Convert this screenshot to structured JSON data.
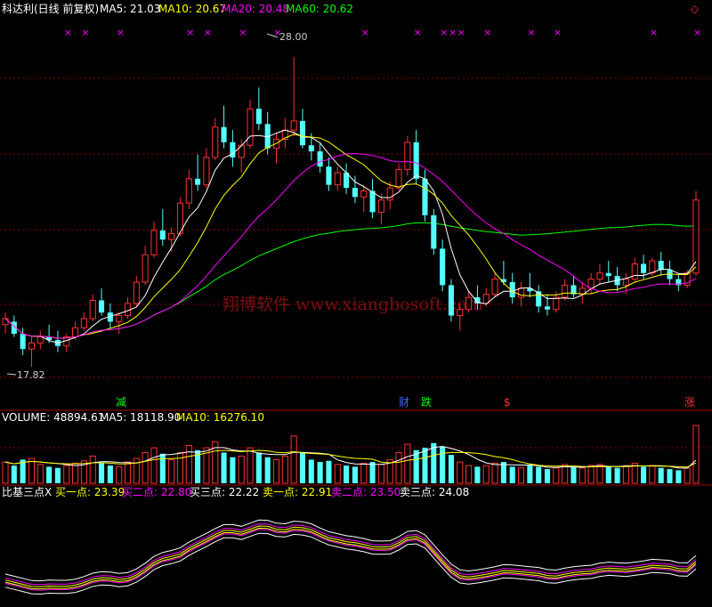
{
  "main_panel": {
    "title": "科达利(日线 前复权)",
    "ma_labels": [
      {
        "text": "MA5: 21.03",
        "color": "#ffffff"
      },
      {
        "text": "MA10: 20.67",
        "color": "#ffff00"
      },
      {
        "text": "MA20: 20.48",
        "color": "#ff00ff"
      },
      {
        "text": "MA60: 20.62",
        "color": "#00ff00"
      }
    ],
    "high_label": "28.00",
    "low_label": "17.82",
    "watermark": "翔博软件 www.xiangbosoft.com",
    "corner_symbol": "◇",
    "signal_marks": [
      "×",
      "×",
      "×",
      "×",
      "×",
      "×",
      "×",
      "×",
      "×",
      "×",
      "×",
      "×",
      "×",
      "×",
      "×",
      "×",
      "×"
    ],
    "bottom_marks": [
      {
        "text": "减",
        "color": "#00ff00"
      },
      {
        "text": "财",
        "color": "#3b6bff"
      },
      {
        "text": "跌",
        "color": "#00ff00"
      },
      {
        "text": "$",
        "color": "#ff3030"
      },
      {
        "text": "涨",
        "color": "#ff3030"
      }
    ]
  },
  "volume_panel": {
    "labels": [
      {
        "text": "VOLUME: 48894.61",
        "color": "#ffffff"
      },
      {
        "text": "MA5: 18118.90",
        "color": "#ffffff"
      },
      {
        "text": "MA10: 16276.10",
        "color": "#ffff00"
      }
    ]
  },
  "indicator_panel": {
    "labels": [
      {
        "text": "比基三点X",
        "color": "#ffffff"
      },
      {
        "text": "买一点: 23.39",
        "color": "#ffff00"
      },
      {
        "text": "买二点: 22.80",
        "color": "#ff00ff"
      },
      {
        "text": "买三点: 22.22",
        "color": "#ffffff"
      },
      {
        "text": "卖一点: 22.91",
        "color": "#ffff00"
      },
      {
        "text": "卖二点: 23.50",
        "color": "#ff00ff"
      },
      {
        "text": "卖三点: 24.08",
        "color": "#ffffff"
      }
    ]
  },
  "chart_data": {
    "type": "candlestick",
    "title": "科达利(日线 前复权)",
    "ylim": [
      17.0,
      29.0
    ],
    "y_markers": {
      "high": 28.0,
      "low": 17.82
    },
    "colors": {
      "up": "#ff3030",
      "down": "#54ffff",
      "ma5": "#ffffff",
      "ma10": "#ffff00",
      "ma20": "#ff00ff",
      "ma60": "#00ff00"
    },
    "candles": [
      [
        19.2,
        19.6,
        18.9,
        19.4
      ],
      [
        19.3,
        19.5,
        18.8,
        18.9
      ],
      [
        18.9,
        19.1,
        18.2,
        18.4
      ],
      [
        18.4,
        18.8,
        17.82,
        18.6
      ],
      [
        18.6,
        19.0,
        18.4,
        18.8
      ],
      [
        18.8,
        19.2,
        18.6,
        18.7
      ],
      [
        18.7,
        19.0,
        18.3,
        18.5
      ],
      [
        18.5,
        18.9,
        18.3,
        18.8
      ],
      [
        18.8,
        19.3,
        18.7,
        19.1
      ],
      [
        19.1,
        19.6,
        19.0,
        19.4
      ],
      [
        19.4,
        20.2,
        19.3,
        20.0
      ],
      [
        20.0,
        20.4,
        19.5,
        19.6
      ],
      [
        19.6,
        19.9,
        19.1,
        19.3
      ],
      [
        19.3,
        19.6,
        18.9,
        19.5
      ],
      [
        19.5,
        20.1,
        19.4,
        19.9
      ],
      [
        19.9,
        20.8,
        19.8,
        20.6
      ],
      [
        20.6,
        21.8,
        20.5,
        21.5
      ],
      [
        21.5,
        22.6,
        21.4,
        22.3
      ],
      [
        22.3,
        23.0,
        21.8,
        22.0
      ],
      [
        22.0,
        22.4,
        21.6,
        22.2
      ],
      [
        22.2,
        23.4,
        22.1,
        23.2
      ],
      [
        23.2,
        24.3,
        23.0,
        24.0
      ],
      [
        24.0,
        24.8,
        23.6,
        23.8
      ],
      [
        23.8,
        25.0,
        23.7,
        24.7
      ],
      [
        24.7,
        26.0,
        24.6,
        25.7
      ],
      [
        25.7,
        26.4,
        25.0,
        25.2
      ],
      [
        25.2,
        25.6,
        24.4,
        24.7
      ],
      [
        24.7,
        25.3,
        24.2,
        25.1
      ],
      [
        25.1,
        26.6,
        25.0,
        26.3
      ],
      [
        26.3,
        27.0,
        25.6,
        25.8
      ],
      [
        25.8,
        26.2,
        24.8,
        25.0
      ],
      [
        25.0,
        25.5,
        24.5,
        25.3
      ],
      [
        25.3,
        26.0,
        25.0,
        25.6
      ],
      [
        25.6,
        28.0,
        25.4,
        25.9
      ],
      [
        25.9,
        26.3,
        25.0,
        25.1
      ],
      [
        25.1,
        25.5,
        24.6,
        24.9
      ],
      [
        24.9,
        25.2,
        24.2,
        24.4
      ],
      [
        24.4,
        24.7,
        23.6,
        23.8
      ],
      [
        23.8,
        24.4,
        23.6,
        24.2
      ],
      [
        24.2,
        24.5,
        23.5,
        23.7
      ],
      [
        23.7,
        24.1,
        23.2,
        23.4
      ],
      [
        23.4,
        23.8,
        22.9,
        23.6
      ],
      [
        23.6,
        24.0,
        22.7,
        22.9
      ],
      [
        22.9,
        23.5,
        22.5,
        23.3
      ],
      [
        23.3,
        23.9,
        23.0,
        23.7
      ],
      [
        23.7,
        24.5,
        23.6,
        24.3
      ],
      [
        24.3,
        25.4,
        24.1,
        25.2
      ],
      [
        25.2,
        25.6,
        23.8,
        24.0
      ],
      [
        24.0,
        24.3,
        22.6,
        22.8
      ],
      [
        22.8,
        23.0,
        21.5,
        21.7
      ],
      [
        21.7,
        22.0,
        20.3,
        20.5
      ],
      [
        20.5,
        20.7,
        19.3,
        19.5
      ],
      [
        19.5,
        19.9,
        19.0,
        19.7
      ],
      [
        19.7,
        20.3,
        19.6,
        20.1
      ],
      [
        20.1,
        20.5,
        19.7,
        19.9
      ],
      [
        19.9,
        20.4,
        19.8,
        20.2
      ],
      [
        20.2,
        20.9,
        20.1,
        20.7
      ],
      [
        20.7,
        21.3,
        20.5,
        20.6
      ],
      [
        20.6,
        20.9,
        19.9,
        20.1
      ],
      [
        20.1,
        20.6,
        19.8,
        20.4
      ],
      [
        20.4,
        20.9,
        20.1,
        20.3
      ],
      [
        20.3,
        20.5,
        19.6,
        19.8
      ],
      [
        19.8,
        20.2,
        19.5,
        19.7
      ],
      [
        19.7,
        20.3,
        19.6,
        20.1
      ],
      [
        20.1,
        20.7,
        20.0,
        20.5
      ],
      [
        20.5,
        20.8,
        20.1,
        20.2
      ],
      [
        20.2,
        20.6,
        19.9,
        20.4
      ],
      [
        20.4,
        20.9,
        20.2,
        20.7
      ],
      [
        20.7,
        21.2,
        20.5,
        20.9
      ],
      [
        20.9,
        21.3,
        20.6,
        20.8
      ],
      [
        20.8,
        21.1,
        20.3,
        20.5
      ],
      [
        20.5,
        20.9,
        20.2,
        20.7
      ],
      [
        20.7,
        21.4,
        20.6,
        21.2
      ],
      [
        21.2,
        21.5,
        20.7,
        20.9
      ],
      [
        20.9,
        21.4,
        20.8,
        21.3
      ],
      [
        21.3,
        21.6,
        20.8,
        21.0
      ],
      [
        21.0,
        21.3,
        20.5,
        20.7
      ],
      [
        20.7,
        20.9,
        20.3,
        20.5
      ],
      [
        20.5,
        21.0,
        20.4,
        20.9
      ],
      [
        20.9,
        23.6,
        20.8,
        23.3
      ]
    ],
    "volume": [
      180,
      150,
      200,
      210,
      160,
      140,
      130,
      150,
      170,
      190,
      230,
      170,
      150,
      140,
      180,
      210,
      260,
      300,
      250,
      200,
      260,
      320,
      280,
      300,
      350,
      260,
      220,
      230,
      300,
      260,
      220,
      200,
      230,
      400,
      260,
      200,
      180,
      190,
      160,
      150,
      140,
      170,
      180,
      160,
      200,
      260,
      330,
      280,
      300,
      340,
      310,
      240,
      180,
      150,
      140,
      150,
      170,
      180,
      140,
      130,
      150,
      140,
      120,
      130,
      160,
      140,
      130,
      150,
      160,
      140,
      130,
      150,
      170,
      140,
      150,
      130,
      120,
      110,
      130,
      489
    ],
    "indicator": {
      "series_names": [
        "买一点",
        "买二点",
        "买三点",
        "卖一点",
        "卖二点",
        "卖三点"
      ],
      "last_values": [
        23.39,
        22.8,
        22.22,
        22.91,
        23.5,
        24.08
      ]
    }
  }
}
